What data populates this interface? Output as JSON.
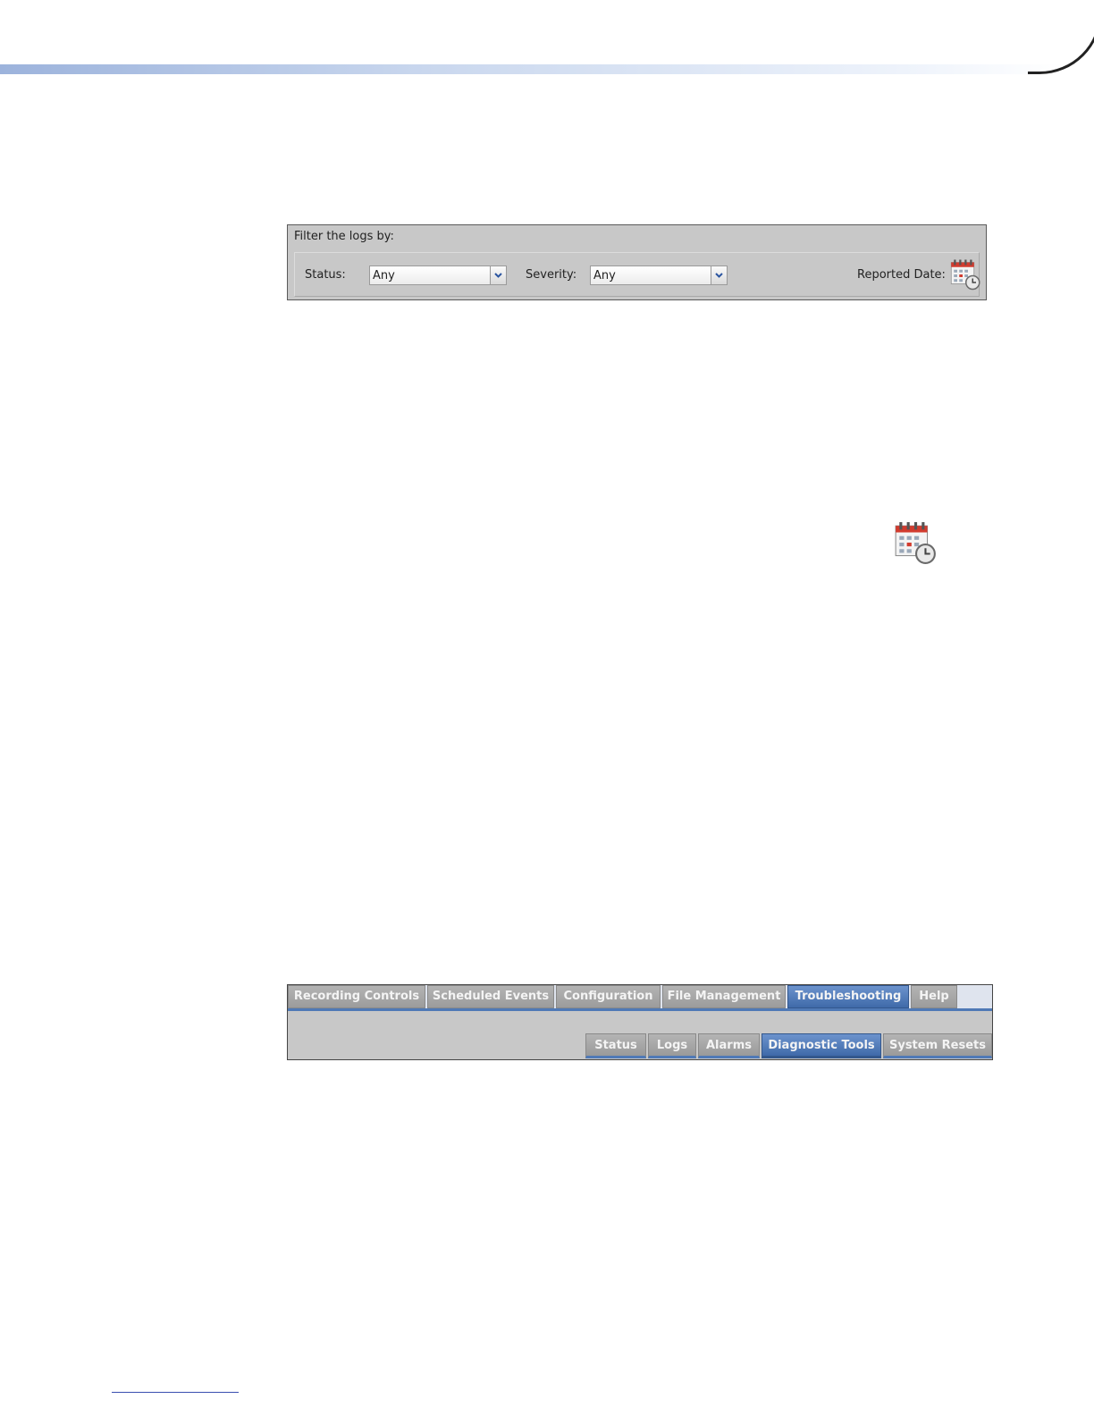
{
  "filter_panel": {
    "title": "Filter the logs by:",
    "status_label": "Status:",
    "status_value": "Any",
    "severity_label": "Severity:",
    "severity_value": "Any",
    "reported_date_label": "Reported Date:",
    "calendar_icon": "calendar-clock-icon"
  },
  "standalone_icon": "calendar-clock-icon",
  "tabs": {
    "main": [
      {
        "label": "Recording Controls",
        "active": false
      },
      {
        "label": "Scheduled Events",
        "active": false
      },
      {
        "label": "Configuration",
        "active": false
      },
      {
        "label": "File Management",
        "active": false
      },
      {
        "label": "Troubleshooting",
        "active": true
      },
      {
        "label": "Help",
        "active": false
      }
    ],
    "sub": [
      {
        "label": "Status",
        "active": false
      },
      {
        "label": "Logs",
        "active": false
      },
      {
        "label": "Alarms",
        "active": false
      },
      {
        "label": "Diagnostic Tools",
        "active": true
      },
      {
        "label": "System Resets",
        "active": false
      }
    ]
  },
  "colors": {
    "accent_blue": "#4f79b6",
    "panel_gray": "#c8c8c8"
  }
}
